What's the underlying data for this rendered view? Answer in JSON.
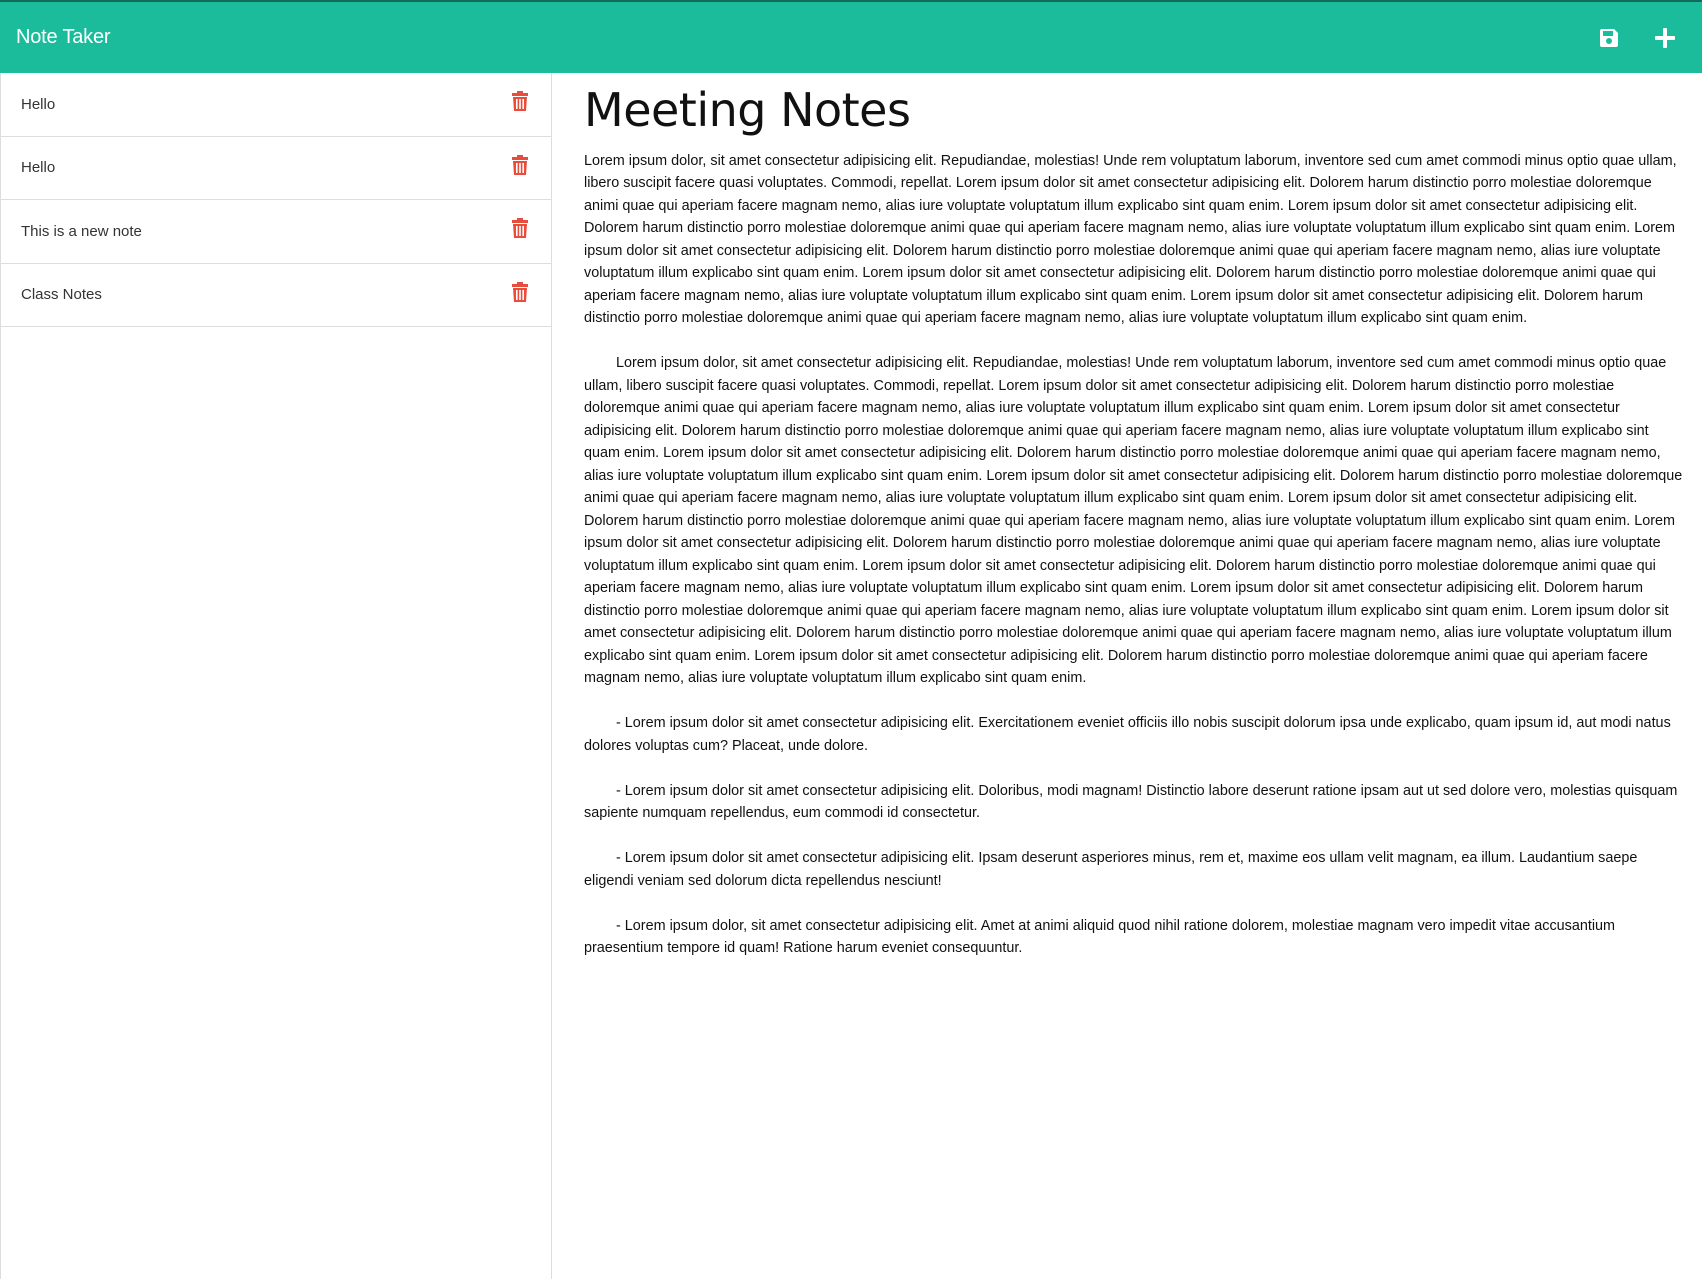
{
  "app": {
    "title": "Note Taker",
    "accent_color": "#1abc9c",
    "delete_color": "#e74c3c"
  },
  "toolbar": {
    "save_icon": "save-icon",
    "new_icon": "plus-icon"
  },
  "sidebar": {
    "notes": [
      {
        "title": "Hello"
      },
      {
        "title": "Hello"
      },
      {
        "title": "This is a new note"
      },
      {
        "title": "Class Notes"
      }
    ]
  },
  "note": {
    "title": "Meeting Notes",
    "body": "Lorem ipsum dolor, sit amet consectetur adipisicing elit. Repudiandae, molestias! Unde rem voluptatum laborum, inventore sed cum amet commodi minus optio quae ullam, libero suscipit facere quasi voluptates. Commodi, repellat. Lorem ipsum dolor sit amet consectetur adipisicing elit. Dolorem harum distinctio porro molestiae doloremque animi quae qui aperiam facere magnam nemo, alias iure voluptate voluptatum illum explicabo sint quam enim. Lorem ipsum dolor sit amet consectetur adipisicing elit. Dolorem harum distinctio porro molestiae doloremque animi quae qui aperiam facere magnam nemo, alias iure voluptate voluptatum illum explicabo sint quam enim. Lorem ipsum dolor sit amet consectetur adipisicing elit. Dolorem harum distinctio porro molestiae doloremque animi quae qui aperiam facere magnam nemo, alias iure voluptate voluptatum illum explicabo sint quam enim. Lorem ipsum dolor sit amet consectetur adipisicing elit. Dolorem harum distinctio porro molestiae doloremque animi quae qui aperiam facere magnam nemo, alias iure voluptate voluptatum illum explicabo sint quam enim. Lorem ipsum dolor sit amet consectetur adipisicing elit. Dolorem harum distinctio porro molestiae doloremque animi quae qui aperiam facere magnam nemo, alias iure voluptate voluptatum illum explicabo sint quam enim.\n\n        Lorem ipsum dolor, sit amet consectetur adipisicing elit. Repudiandae, molestias! Unde rem voluptatum laborum, inventore sed cum amet commodi minus optio quae ullam, libero suscipit facere quasi voluptates. Commodi, repellat. Lorem ipsum dolor sit amet consectetur adipisicing elit. Dolorem harum distinctio porro molestiae doloremque animi quae qui aperiam facere magnam nemo, alias iure voluptate voluptatum illum explicabo sint quam enim. Lorem ipsum dolor sit amet consectetur adipisicing elit. Dolorem harum distinctio porro molestiae doloremque animi quae qui aperiam facere magnam nemo, alias iure voluptate voluptatum illum explicabo sint quam enim. Lorem ipsum dolor sit amet consectetur adipisicing elit. Dolorem harum distinctio porro molestiae doloremque animi quae qui aperiam facere magnam nemo, alias iure voluptate voluptatum illum explicabo sint quam enim. Lorem ipsum dolor sit amet consectetur adipisicing elit. Dolorem harum distinctio porro molestiae doloremque animi quae qui aperiam facere magnam nemo, alias iure voluptate voluptatum illum explicabo sint quam enim. Lorem ipsum dolor sit amet consectetur adipisicing elit. Dolorem harum distinctio porro molestiae doloremque animi quae qui aperiam facere magnam nemo, alias iure voluptate voluptatum illum explicabo sint quam enim. Lorem ipsum dolor sit amet consectetur adipisicing elit. Dolorem harum distinctio porro molestiae doloremque animi quae qui aperiam facere magnam nemo, alias iure voluptate voluptatum illum explicabo sint quam enim. Lorem ipsum dolor sit amet consectetur adipisicing elit. Dolorem harum distinctio porro molestiae doloremque animi quae qui aperiam facere magnam nemo, alias iure voluptate voluptatum illum explicabo sint quam enim. Lorem ipsum dolor sit amet consectetur adipisicing elit. Dolorem harum distinctio porro molestiae doloremque animi quae qui aperiam facere magnam nemo, alias iure voluptate voluptatum illum explicabo sint quam enim. Lorem ipsum dolor sit amet consectetur adipisicing elit. Dolorem harum distinctio porro molestiae doloremque animi quae qui aperiam facere magnam nemo, alias iure voluptate voluptatum illum explicabo sint quam enim. Lorem ipsum dolor sit amet consectetur adipisicing elit. Dolorem harum distinctio porro molestiae doloremque animi quae qui aperiam facere magnam nemo, alias iure voluptate voluptatum illum explicabo sint quam enim.\n\n        - Lorem ipsum dolor sit amet consectetur adipisicing elit. Exercitationem eveniet officiis illo nobis suscipit dolorum ipsa unde explicabo, quam ipsum id, aut modi natus dolores voluptas cum? Placeat, unde dolore.\n\n        - Lorem ipsum dolor sit amet consectetur adipisicing elit. Doloribus, modi magnam! Distinctio labore deserunt ratione ipsam aut ut sed dolore vero, molestias quisquam sapiente numquam repellendus, eum commodi id consectetur.\n\n        - Lorem ipsum dolor sit amet consectetur adipisicing elit. Ipsam deserunt asperiores minus, rem et, maxime eos ullam velit magnam, ea illum. Laudantium saepe eligendi veniam sed dolorum dicta repellendus nesciunt!\n\n        - Lorem ipsum dolor, sit amet consectetur adipisicing elit. Amet at animi aliquid quod nihil ratione dolorem, molestiae magnam vero impedit vitae accusantium praesentium tempore id quam! Ratione harum eveniet consequuntur."
  }
}
